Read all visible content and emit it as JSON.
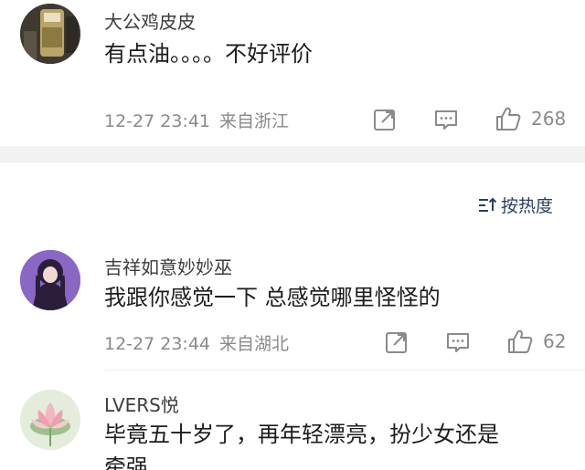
{
  "comments": [
    {
      "username": "大公鸡皮皮",
      "text": "有点油。。。。不好评价",
      "time": "12-27 23:41",
      "location": "来自浙江",
      "likes": "268"
    },
    {
      "username": "吉祥如意妙妙巫",
      "text": "我跟你感觉一下 总感觉哪里怪怪的",
      "time": "12-27 23:44",
      "location": "来自湖北",
      "likes": "62"
    },
    {
      "username": "LVERS悦",
      "text_line1": "毕竟五十岁了，再年轻漂亮，扮少女还是",
      "text_line2": "牵强"
    }
  ],
  "sort": {
    "label": "按热度",
    "icon": "sort-icon"
  },
  "icons": {
    "share": "share-icon",
    "comment": "comment-icon",
    "like": "thumb-up-icon"
  },
  "colors": {
    "username": "#3d3d3d",
    "content": "#1c1c1c",
    "meta": "#8a8a8a",
    "sort": "#2b3f60",
    "separator": "#f2f2f2"
  }
}
